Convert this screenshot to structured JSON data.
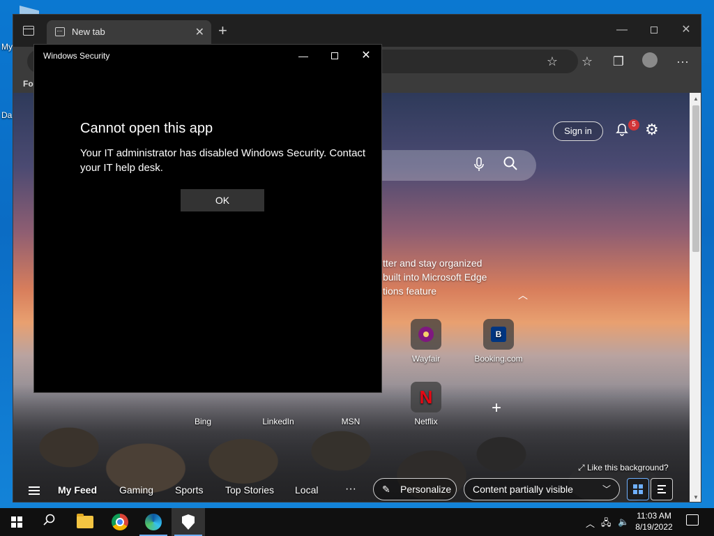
{
  "desktop": {
    "icons": [
      {
        "label": "My"
      },
      {
        "label": "Da"
      }
    ]
  },
  "edge": {
    "tab_title": "New tab",
    "favbar_label": "For",
    "signin_label": "Sign in",
    "notification_count": "5",
    "promo_lines": [
      "tter and stay organized",
      "built into Microsoft Edge",
      "tions feature"
    ],
    "tiles": [
      {
        "label": "Wayfair",
        "icon": "wayfair-icon"
      },
      {
        "label": "Booking.com",
        "icon": "booking-icon",
        "glyph": "B"
      },
      {
        "label": "Bing",
        "icon": "bing-icon"
      },
      {
        "label": "LinkedIn",
        "icon": "linkedin-icon"
      },
      {
        "label": "MSN",
        "icon": "msn-icon"
      },
      {
        "label": "Netflix",
        "icon": "netflix-icon",
        "glyph": "N"
      }
    ],
    "bg_toggle_label": "Like this background?",
    "feed_tabs": [
      "My Feed",
      "Gaming",
      "Sports",
      "Top Stories",
      "Local"
    ],
    "feed_more": "···",
    "personalize_label": "Personalize",
    "content_visibility": "Content partially visible"
  },
  "dialog": {
    "title": "Windows Security",
    "heading": "Cannot open this app",
    "message": "Your IT administrator has disabled Windows Security. Contact your IT help desk.",
    "ok_label": "OK"
  },
  "taskbar": {
    "time": "11:03 AM",
    "date": "8/19/2022"
  },
  "colors": {
    "accent": "#6fb0ff",
    "badge": "#d13438",
    "dialog_bg": "#000000"
  }
}
